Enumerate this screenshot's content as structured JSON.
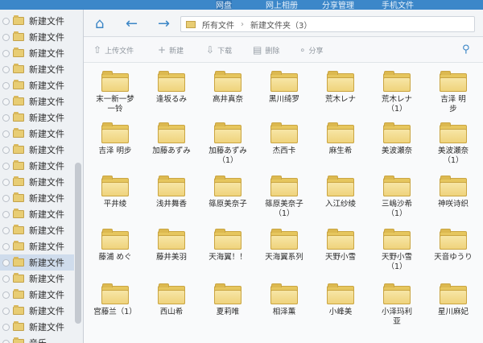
{
  "topbar": {
    "tabs": [
      "网盘",
      "网上相册",
      "分享管理",
      "手机文件"
    ]
  },
  "sidebar": {
    "items": [
      "新建文件",
      "新建文件",
      "新建文件",
      "新建文件",
      "新建文件",
      "新建文件",
      "新建文件",
      "新建文件",
      "新建文件",
      "新建文件",
      "新建文件",
      "新建文件",
      "新建文件",
      "新建文件",
      "新建文件",
      "新建文件",
      "新建文件",
      "新建文件",
      "新建文件",
      "新建文件",
      "音乐"
    ],
    "selected_index": 15
  },
  "navbar": {
    "back_icon": "arrow-left",
    "forward_icon": "arrow-right",
    "home_icon": "home",
    "path": [
      "所有文件",
      "新建文件夹（3）"
    ],
    "separator": "›"
  },
  "toolbar": {
    "upload": "上传文件",
    "new": "新建",
    "download": "下载",
    "delete": "删除",
    "share": "分享"
  },
  "files": [
    [
      "末一新一梦",
      "一铃"
    ],
    [
      "逢坂るみ",
      ""
    ],
    [
      "高井真奈",
      ""
    ],
    [
      "黑川绮罗",
      ""
    ],
    [
      "荒木レナ",
      ""
    ],
    [
      "荒木レナ",
      "（1）"
    ],
    [
      "吉泽 明",
      "步"
    ],
    [
      "吉泽 明步",
      ""
    ],
    [
      "加藤あずみ",
      ""
    ],
    [
      "加藤あずみ",
      "（1）"
    ],
    [
      "杰西卡",
      ""
    ],
    [
      "麻生希",
      ""
    ],
    [
      "美波瀬奈",
      ""
    ],
    [
      "美波瀬奈",
      "（1）"
    ],
    [
      "平井绫",
      ""
    ],
    [
      "浅井舞香",
      ""
    ],
    [
      "篠原美奈子",
      ""
    ],
    [
      "篠原美奈子",
      "（1）"
    ],
    [
      "入江纱绫",
      ""
    ],
    [
      "三嶋沙希",
      "（1）"
    ],
    [
      "神咲诗织",
      ""
    ],
    [
      "藤浦 めぐ",
      ""
    ],
    [
      "藤井美羽",
      ""
    ],
    [
      "天海翼！！",
      ""
    ],
    [
      "天海翼系列",
      ""
    ],
    [
      "天野小雪",
      ""
    ],
    [
      "天野小雪",
      "（1）"
    ],
    [
      "天音ゆうり",
      ""
    ],
    [
      "宫藤兰（1）",
      ""
    ],
    [
      "西山希",
      ""
    ],
    [
      "夏莉唯",
      ""
    ],
    [
      "相泽薰",
      ""
    ],
    [
      "小峰美",
      ""
    ],
    [
      "小泽玛利",
      "亚"
    ],
    [
      "星川麻妃",
      ""
    ]
  ]
}
